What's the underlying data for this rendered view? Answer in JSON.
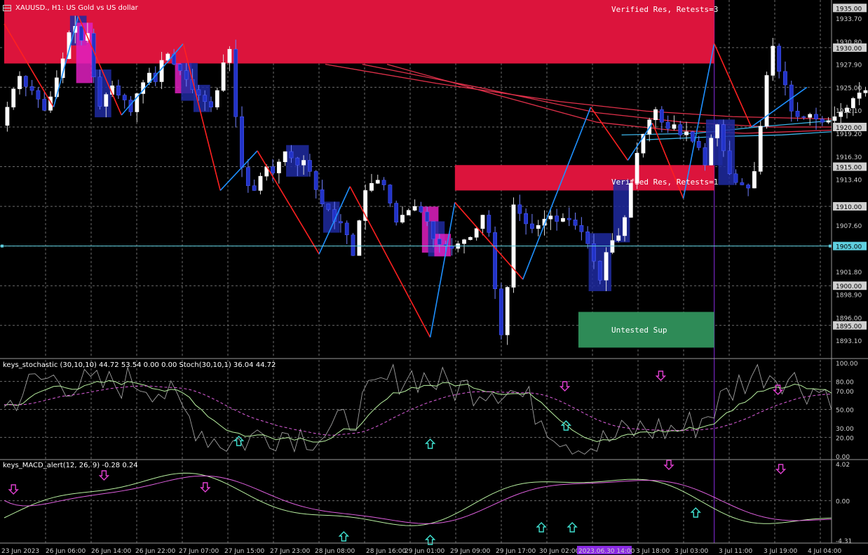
{
  "header": {
    "symbol_title": "XAUUSD., H1: US Gold vs US dollar",
    "stoch_title": "keys_stochastic (30,10,10) 44.72 53.54 0.00 0.00 Stoch(30,10,1) 36.04 44.72",
    "macd_title": "keys_MACD_alert(12, 26, 9) -0.28 0.24"
  },
  "zones": [
    {
      "label": "Verified Res, Retests=3",
      "low": 1928.0,
      "high": 1936.0,
      "from": 0,
      "to": 115,
      "color": "#dc143c"
    },
    {
      "label": "Verified Res, Retests=1",
      "low": 1912.0,
      "high": 1915.2,
      "from": 73,
      "to": 115,
      "color": "#dc143c"
    },
    {
      "label": "Untested Sup",
      "low": 1892.2,
      "high": 1896.7,
      "from": 93,
      "to": 115,
      "color": "#2e8b57"
    }
  ],
  "colors": {
    "background": "#000000",
    "bull_candle": "#ffffff",
    "bear_candle": "#1e2aa0",
    "zigzag_up": "#1e90ff",
    "zigzag_down": "#ff2020",
    "ma_red": "#e0304a",
    "ma_blue": "#3cb4e8",
    "grid": "#6b6b6b",
    "signal_up": "#40e0d0",
    "signal_down": "#e040d0"
  },
  "chart_data": [
    {
      "type": "candlestick",
      "title": "XAUUSD., H1: US Gold vs US dollar",
      "y_axis_ticks": [
        "1935.00",
        "1933.70",
        "1930.80",
        "1930.00",
        "1927.90",
        "1925.00",
        "1922.10",
        "1920.00",
        "1919.20",
        "1916.30",
        "1915.00",
        "1913.40",
        "1910.00",
        "1907.60",
        "1905.00",
        "1901.80",
        "1900.00",
        "1898.90",
        "1896.00",
        "1895.00",
        "1893.10"
      ],
      "x_axis_ticks": [
        "23 Jun 2023",
        "26 Jun 06:00",
        "26 Jun 14:00",
        "26 Jun 22:00",
        "27 Jun 07:00",
        "27 Jun 15:00",
        "27 Jun 23:00",
        "28 Jun 08:00",
        "28 Jun 16:00",
        "29 Jun 01:00",
        "29 Jun 09:00",
        "29 Jun 17:00",
        "30 Jun 02:00",
        "2023.06.30 14:00",
        "3 Jul 18:00",
        "3 Jul 03:00",
        "3 Jul 11:00",
        "3 Jul 19:00",
        "4 Jul 04:00"
      ],
      "ylim": [
        1891.0,
        1936.0
      ],
      "horizontal_lines": [
        {
          "price": 1905.0,
          "label": "1905.00"
        }
      ],
      "ohlc_path": [
        1920.2,
        1922.5,
        1924.8,
        1926.4,
        1925.1,
        1924.6,
        1923.5,
        1922.1,
        1923.8,
        1926.2,
        1928.6,
        1931.9,
        1932.7,
        1930.9,
        1931.8,
        1926.3,
        1922.6,
        1924.1,
        1925.2,
        1924.0,
        1923.4,
        1921.9,
        1924.2,
        1925.6,
        1926.8,
        1925.7,
        1928.4,
        1929.2,
        1927.9,
        1927.1,
        1926.0,
        1924.7,
        1924.0,
        1923.2,
        1922.5,
        1924.6,
        1928.1,
        1929.8,
        1921.3,
        1914.9,
        1912.6,
        1912.0,
        1913.8,
        1915.0,
        1914.2,
        1915.6,
        1916.9,
        1916.1,
        1915.2,
        1915.8,
        1914.4,
        1912.1,
        1910.3,
        1909.6,
        1908.1,
        1907.9,
        1906.4,
        1903.8,
        1908.2,
        1912.0,
        1912.9,
        1913.3,
        1912.7,
        1910.4,
        1908.0,
        1908.9,
        1909.5,
        1910.0,
        1909.3,
        1908.1,
        1905.9,
        1905.2,
        1905.0,
        1904.7,
        1905.3,
        1905.8,
        1906.1,
        1907.2,
        1908.9,
        1906.7,
        1899.6,
        1893.8,
        1899.8,
        1910.2,
        1909.1,
        1907.8,
        1907.2,
        1907.6,
        1908.4,
        1908.8,
        1908.1,
        1908.5,
        1908.3,
        1907.6,
        1906.8,
        1905.3,
        1903.1,
        1900.7,
        1904.2,
        1905.7,
        1906.3,
        1908.6,
        1912.9,
        1916.7,
        1919.1,
        1920.9,
        1922.2,
        1920.6,
        1919.8,
        1920.3,
        1919.0,
        1919.4,
        1918.2,
        1917.4,
        1915.2,
        1918.6,
        1920.3,
        1917.0,
        1914.1,
        1913.0,
        1912.7,
        1912.3,
        1914.4,
        1920.1,
        1926.5,
        1930.2,
        1927.0,
        1925.3,
        1922.0,
        1921.3,
        1921.2,
        1921.6,
        1921.0,
        1920.6,
        1920.8,
        1921.3,
        1921.9,
        1922.4,
        1923.6,
        1924.3,
        1924.6
      ],
      "zigzag": [
        [
          0,
          1933.0
        ],
        [
          8,
          1922.5
        ],
        [
          12,
          1934.0
        ],
        [
          19,
          1921.5
        ],
        [
          29,
          1930.5
        ],
        [
          35,
          1912.0
        ],
        [
          41,
          1917.0
        ],
        [
          51,
          1904.0
        ],
        [
          56,
          1912.5
        ],
        [
          69,
          1893.5
        ],
        [
          73,
          1910.5
        ],
        [
          84,
          1900.8
        ],
        [
          95,
          1922.5
        ],
        [
          101,
          1915.8
        ],
        [
          105,
          1920.5
        ],
        [
          110,
          1911.0
        ],
        [
          115,
          1930.5
        ],
        [
          121,
          1920.0
        ],
        [
          130,
          1925.0
        ]
      ]
    },
    {
      "type": "line",
      "title": "keys_stochastic (30,10,10)",
      "series": [
        {
          "name": "keys_stochastic (30,10,10)",
          "values": [
            44.72,
            53.54
          ]
        },
        {
          "name": "Stoch(30,10,1)",
          "values": [
            36.04,
            44.72
          ]
        }
      ],
      "y_axis_ticks": [
        "100.00",
        "80.00",
        "70.00",
        "50.00",
        "30.00",
        "20.00",
        "0.00"
      ],
      "ylim": [
        0,
        100
      ]
    },
    {
      "type": "line",
      "title": "keys_MACD_alert(12, 26, 9)",
      "series": [
        {
          "name": "keys_MACD_alert(12, 26, 9)",
          "values": [
            -0.28,
            0.24
          ]
        }
      ],
      "y_axis_ticks": [
        "4.02",
        "0.00",
        "-4.31"
      ],
      "ylim": [
        -4.31,
        4.02
      ]
    }
  ]
}
